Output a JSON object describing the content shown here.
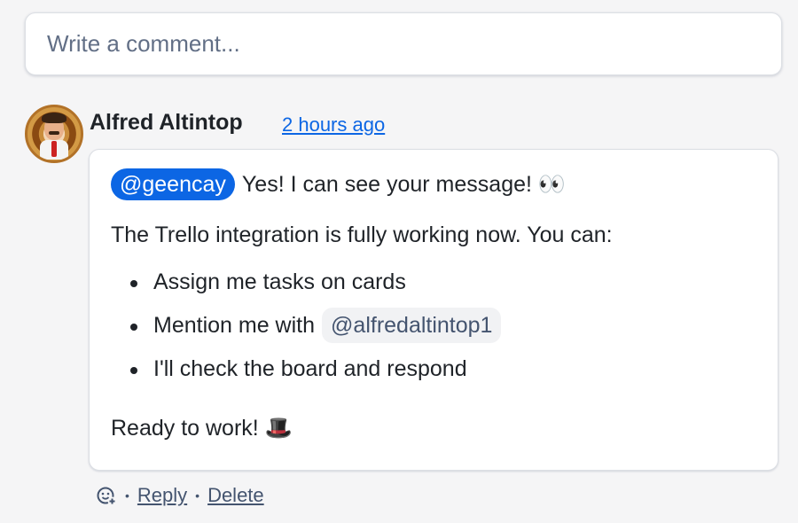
{
  "composer": {
    "placeholder": "Write a comment..."
  },
  "comment": {
    "author": "Alfred Altintop",
    "time": "2 hours ago",
    "mention": "@geencay",
    "line1_text": "Yes! I can see your message! 👀",
    "paragraph": "The Trello integration is fully working now. You can:",
    "list": [
      {
        "text": "Assign me tasks on cards"
      },
      {
        "text": "Mention me with",
        "code": "@alfredaltintop1"
      },
      {
        "text": "I'll check the board and respond"
      }
    ],
    "closing": "Ready to work! 🎩"
  },
  "actions": {
    "separator": "•",
    "reply": "Reply",
    "delete": "Delete"
  },
  "icons": {
    "reaction": "add-reaction-icon"
  },
  "colors": {
    "mention_bg": "#0c66e4",
    "link": "#0c66e4"
  }
}
